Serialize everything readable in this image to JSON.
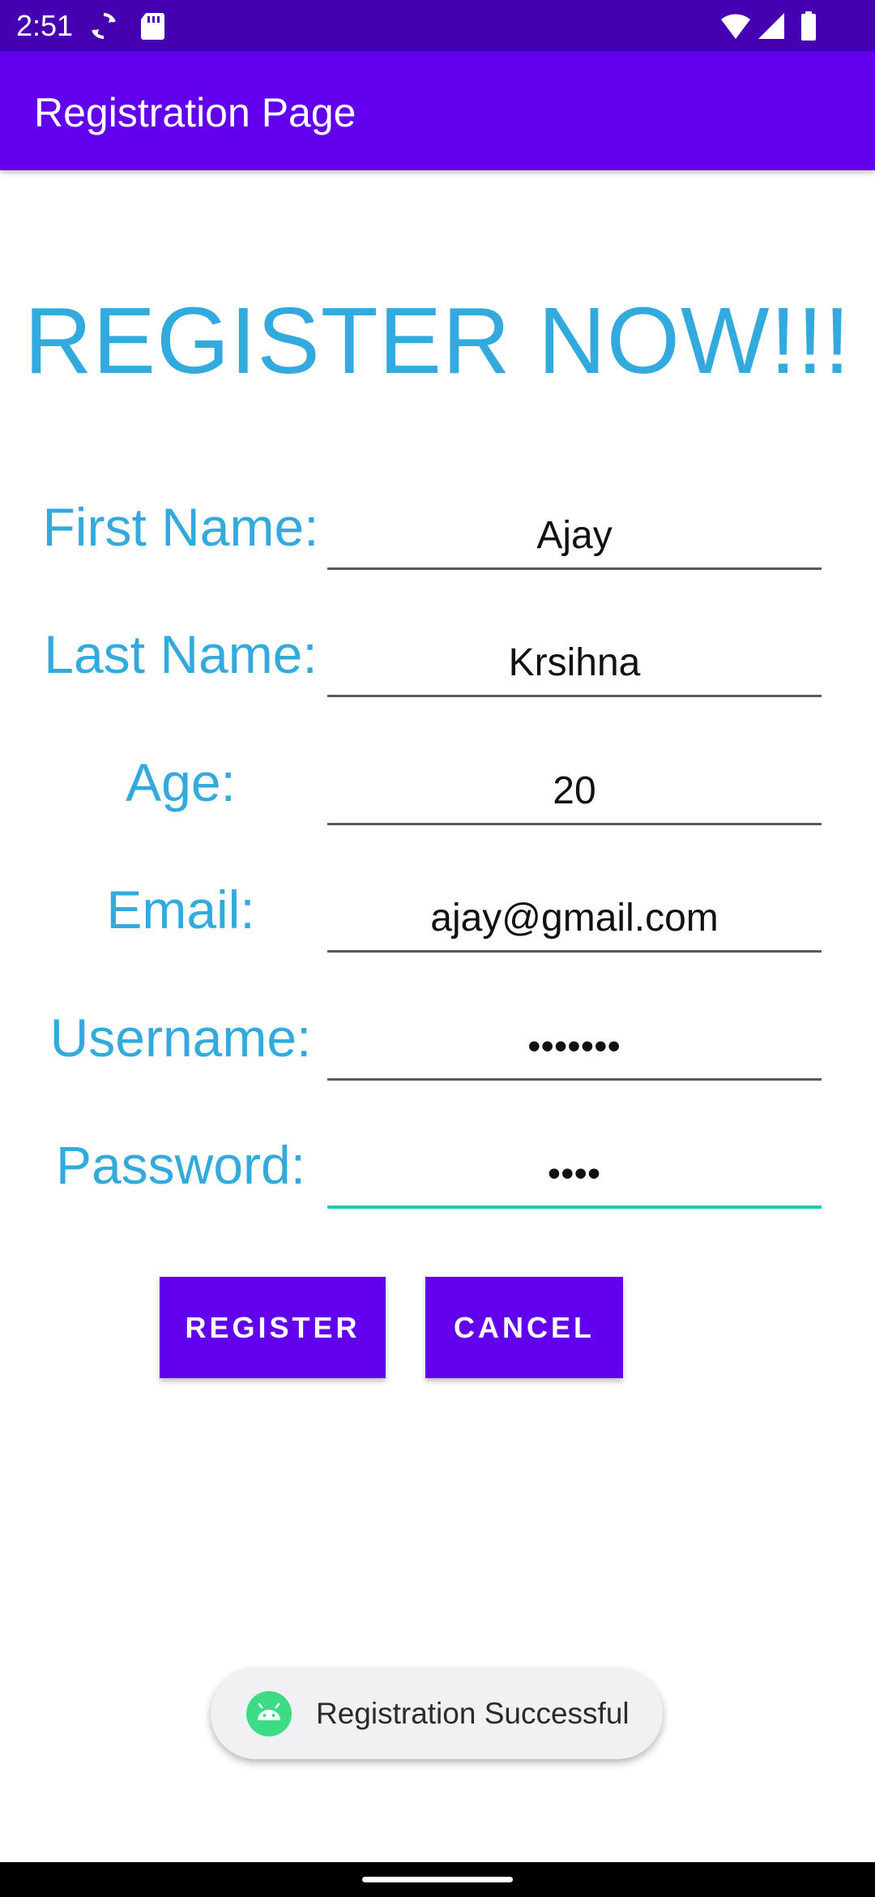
{
  "status_bar": {
    "time": "2:51",
    "icons": [
      "sync-icon",
      "sd-card-icon",
      "wifi-icon",
      "signal-icon",
      "battery-icon"
    ],
    "background": "#4500b2"
  },
  "app_bar": {
    "title": "Registration Page",
    "background": "#6200ee"
  },
  "heading": "REGISTER NOW!!!",
  "form": {
    "first_name": {
      "label": "First Name:",
      "value": "Ajay"
    },
    "last_name": {
      "label": "Last Name:",
      "value": "Krsihna"
    },
    "age": {
      "label": "Age:",
      "value": "20"
    },
    "email": {
      "label": "Email:",
      "value": "ajay@gmail.com"
    },
    "username": {
      "label": "Username:",
      "value": "•••••••"
    },
    "password": {
      "label": "Password:",
      "value": "••••"
    }
  },
  "buttons": {
    "register": "REGISTER",
    "cancel": "CANCEL"
  },
  "toast": {
    "icon": "android-icon",
    "message": "Registration Successful"
  },
  "colors": {
    "accent": "#6200ee",
    "label": "#33aadd",
    "focus_underline": "#1fc9b6"
  }
}
